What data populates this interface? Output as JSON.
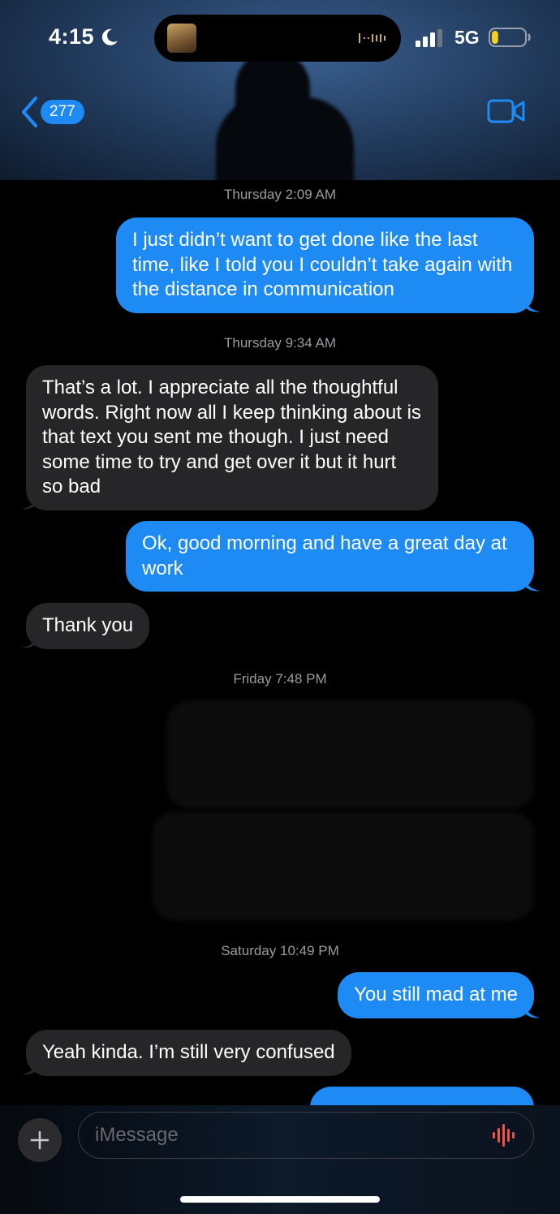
{
  "status_bar": {
    "time": "4:15",
    "network": "5G",
    "focus_icon": "moon-icon",
    "battery_level": 0.2,
    "battery_color": "#f5d020"
  },
  "header": {
    "unread_count": "277",
    "video_icon": "video-camera-icon",
    "accent_color": "#1e8bf5"
  },
  "thread": [
    {
      "type": "timestamp",
      "day": "Thursday",
      "time": "2:09 AM"
    },
    {
      "type": "sent",
      "text": "I just didn’t want to get done like the last time, like I told you I couldn’t take again with the distance in communication"
    },
    {
      "type": "timestamp",
      "day": "Thursday",
      "time": "9:34 AM"
    },
    {
      "type": "received",
      "text": "That’s a lot. I appreciate all the thoughtful words. Right now all I keep thinking about is that text you sent me though. I just need some time to try and get over it but it hurt so bad"
    },
    {
      "type": "sent",
      "text": "Ok, good morning and have a great day at work"
    },
    {
      "type": "received",
      "text": "Thank you"
    },
    {
      "type": "timestamp",
      "day": "Friday",
      "time": "7:48 PM"
    },
    {
      "type": "sent_redacted"
    },
    {
      "type": "sent_redacted"
    },
    {
      "type": "timestamp",
      "day": "Saturday",
      "time": "10:49 PM"
    },
    {
      "type": "sent",
      "text": "You still mad at me"
    },
    {
      "type": "received",
      "text": "Yeah kinda. I’m still very confused"
    },
    {
      "type": "sent_partial"
    }
  ],
  "composer": {
    "placeholder": "iMessage",
    "plus_icon": "plus-icon",
    "dictation_icon": "dictation-waveform-icon",
    "dictation_color": "#f0524a"
  }
}
